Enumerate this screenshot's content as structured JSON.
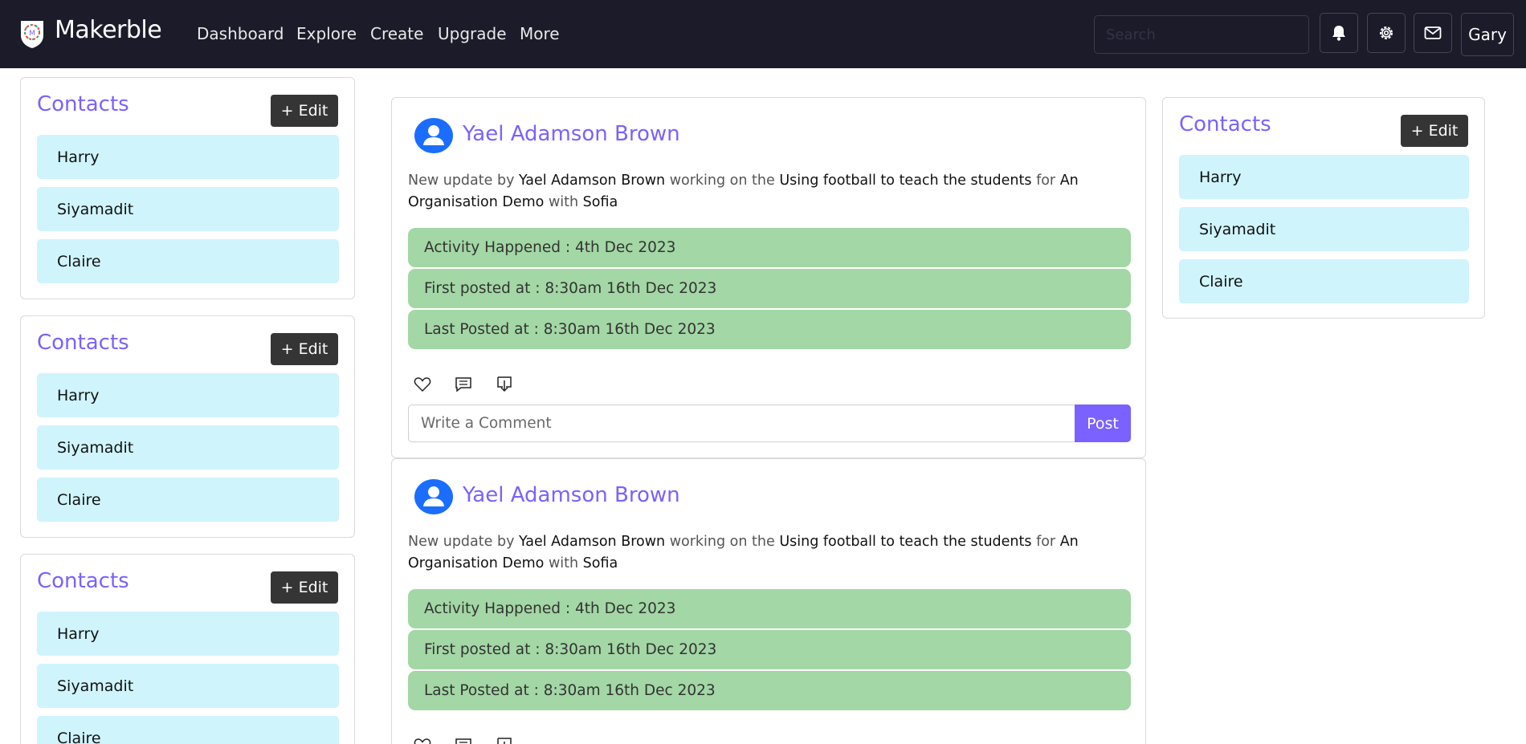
{
  "app": {
    "name": "Makerble"
  },
  "nav": {
    "links": [
      "Dashboard",
      "Explore",
      "Create",
      "Upgrade",
      "More"
    ],
    "search_placeholder": "Search",
    "user": "Gary"
  },
  "contact_cards": [
    {
      "title": "Contacts",
      "edit_label": "+ Edit",
      "items": [
        "Harry",
        "Siyamadit",
        "Claire"
      ]
    },
    {
      "title": "Contacts",
      "edit_label": "+ Edit",
      "items": [
        "Harry",
        "Siyamadit",
        "Claire"
      ]
    },
    {
      "title": "Contacts",
      "edit_label": "+ Edit",
      "items": [
        "Harry",
        "Siyamadit",
        "Claire"
      ]
    },
    {
      "title": "Contacts",
      "edit_label": "+ Edit",
      "items": [
        "Harry",
        "Siyamadit",
        "Claire"
      ]
    }
  ],
  "posts": [
    {
      "author": "Yael Adamson Brown",
      "desc": {
        "t1": "New update by ",
        "author": "Yael Adamson Brown",
        "t2": " working on the ",
        "project": "Using football to teach the students",
        "t3": " for ",
        "org": "An Organisation Demo",
        "t4": " with ",
        "with": "Sofia"
      },
      "activity": "Activity Happened : 4th Dec 2023",
      "first_posted": "First posted at : 8:30am 16th Dec 2023",
      "last_posted": "Last Posted at : 8:30am 16th Dec 2023",
      "comment_placeholder": "Write a Comment",
      "post_label": "Post"
    },
    {
      "author": "Yael Adamson Brown",
      "desc": {
        "t1": "New update by ",
        "author": "Yael Adamson Brown",
        "t2": " working on the ",
        "project": "Using football to teach the students",
        "t3": " for ",
        "org": "An Organisation Demo",
        "t4": " with ",
        "with": "Sofia"
      },
      "activity": "Activity Happened : 4th Dec 2023",
      "first_posted": "First posted at : 8:30am 16th Dec 2023",
      "last_posted": "Last Posted at : 8:30am 16th Dec 2023"
    }
  ],
  "colors": {
    "navbar": "#1b1b2a",
    "accent": "#7b61ff",
    "contact_bg": "#cff4fc",
    "info_bg": "#a3d7a5",
    "edit_bg": "#353535"
  }
}
